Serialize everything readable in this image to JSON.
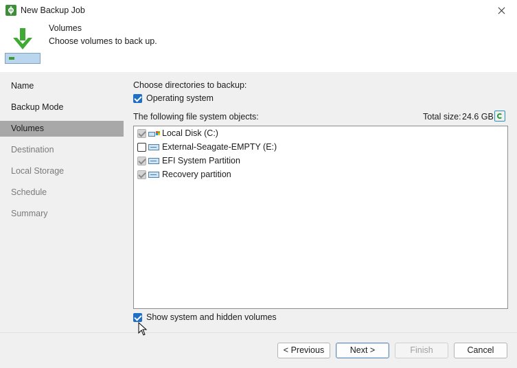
{
  "window": {
    "title": "New Backup Job"
  },
  "header": {
    "title": "Volumes",
    "subtitle": "Choose volumes to back up."
  },
  "sidebar": {
    "items": [
      {
        "label": "Name",
        "state": "enabled"
      },
      {
        "label": "Backup Mode",
        "state": "enabled"
      },
      {
        "label": "Volumes",
        "state": "active"
      },
      {
        "label": "Destination",
        "state": "disabled"
      },
      {
        "label": "Local Storage",
        "state": "disabled"
      },
      {
        "label": "Schedule",
        "state": "disabled"
      },
      {
        "label": "Summary",
        "state": "disabled"
      }
    ]
  },
  "main": {
    "choose_label": "Choose directories to backup:",
    "os_option": {
      "label": "Operating system",
      "checked": true
    },
    "objects_label": "The following file system objects:",
    "total_size_label": "Total size:",
    "total_size_value": "24.6 GB",
    "volumes": [
      {
        "label": "Local Disk (C:)",
        "checked": true,
        "grayed": true,
        "icon": "windows-drive-icon"
      },
      {
        "label": "External-Seagate-EMPTY (E:)",
        "checked": false,
        "grayed": false,
        "icon": "volume-icon"
      },
      {
        "label": "EFI System Partition",
        "checked": true,
        "grayed": true,
        "icon": "volume-icon"
      },
      {
        "label": "Recovery partition",
        "checked": true,
        "grayed": true,
        "icon": "volume-icon"
      }
    ],
    "show_hidden": {
      "label": "Show system and hidden volumes",
      "checked": true
    }
  },
  "footer": {
    "previous_label": "< Previous",
    "next_label": "Next >",
    "finish_label": "Finish",
    "cancel_label": "Cancel"
  },
  "colors": {
    "accent": "#1f6fc5",
    "active_nav": "#a8a8a8",
    "panel_bg": "#f0f0f0"
  }
}
